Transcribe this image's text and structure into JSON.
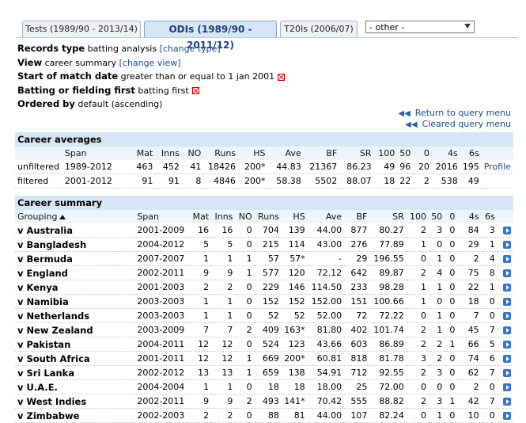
{
  "tabs": [
    {
      "label": "Tests (1989/90 - 2013/14)"
    },
    {
      "label": "ODIs (1989/90 - 2011/12)"
    },
    {
      "label": "T20Is (2006/07)"
    }
  ],
  "other_select": {
    "value": "- other -"
  },
  "query": {
    "records_label": "Records type",
    "records_value": "batting analysis",
    "records_link": "[change type]",
    "view_label": "View",
    "view_value": "career summary",
    "view_link": "[change view]",
    "start_label": "Start of match date",
    "start_value": "greater than or equal to 1 jan 2001",
    "bat_label": "Batting or fielding first",
    "bat_value": "batting first",
    "order_label": "Ordered by",
    "order_value": "default (ascending)"
  },
  "links": {
    "return": "Return to query menu",
    "cleared": "Cleared query menu"
  },
  "averages": {
    "caption": "Career averages",
    "headers": [
      "",
      "Span",
      "Mat",
      "Inns",
      "NO",
      "Runs",
      "HS",
      "Ave",
      "BF",
      "SR",
      "100",
      "50",
      "0",
      "4s",
      "6s",
      ""
    ],
    "rows": [
      [
        "unfiltered",
        "1989-2012",
        "463",
        "452",
        "41",
        "18426",
        "200*",
        "44.83",
        "21367",
        "86.23",
        "49",
        "96",
        "20",
        "2016",
        "195",
        "Profile"
      ],
      [
        "filtered",
        "2001-2012",
        "91",
        "91",
        "8",
        "4846",
        "200*",
        "58.38",
        "5502",
        "88.07",
        "18",
        "22",
        "2",
        "538",
        "49",
        ""
      ]
    ]
  },
  "summary": {
    "caption": "Career summary",
    "headers": [
      "Grouping",
      "Span",
      "Mat",
      "Inns",
      "NO",
      "Runs",
      "HS",
      "Ave",
      "BF",
      "SR",
      "100",
      "50",
      "0",
      "4s",
      "6s"
    ],
    "rows": [
      [
        "v Australia",
        "2001-2009",
        "16",
        "16",
        "0",
        "704",
        "139",
        "44.00",
        "877",
        "80.27",
        "2",
        "3",
        "0",
        "84",
        "3"
      ],
      [
        "v Bangladesh",
        "2004-2012",
        "5",
        "5",
        "0",
        "215",
        "114",
        "43.00",
        "276",
        "77.89",
        "1",
        "0",
        "0",
        "29",
        "1"
      ],
      [
        "v Bermuda",
        "2007-2007",
        "1",
        "1",
        "1",
        "57",
        "57*",
        "-",
        "29",
        "196.55",
        "0",
        "1",
        "0",
        "2",
        "4"
      ],
      [
        "v England",
        "2002-2011",
        "9",
        "9",
        "1",
        "577",
        "120",
        "72.12",
        "642",
        "89.87",
        "2",
        "4",
        "0",
        "75",
        "8"
      ],
      [
        "v Kenya",
        "2001-2003",
        "2",
        "2",
        "0",
        "229",
        "146",
        "114.50",
        "233",
        "98.28",
        "1",
        "1",
        "0",
        "22",
        "1"
      ],
      [
        "v Namibia",
        "2003-2003",
        "1",
        "1",
        "0",
        "152",
        "152",
        "152.00",
        "151",
        "100.66",
        "1",
        "0",
        "0",
        "18",
        "0"
      ],
      [
        "v Netherlands",
        "2003-2003",
        "1",
        "1",
        "0",
        "52",
        "52",
        "52.00",
        "72",
        "72.22",
        "0",
        "1",
        "0",
        "7",
        "0"
      ],
      [
        "v New Zealand",
        "2003-2009",
        "7",
        "7",
        "2",
        "409",
        "163*",
        "81.80",
        "402",
        "101.74",
        "2",
        "1",
        "0",
        "45",
        "7"
      ],
      [
        "v Pakistan",
        "2004-2011",
        "12",
        "12",
        "0",
        "524",
        "123",
        "43.66",
        "603",
        "86.89",
        "2",
        "2",
        "1",
        "66",
        "5"
      ],
      [
        "v South Africa",
        "2001-2011",
        "12",
        "12",
        "1",
        "669",
        "200*",
        "60.81",
        "818",
        "81.78",
        "3",
        "2",
        "0",
        "74",
        "6"
      ],
      [
        "v Sri Lanka",
        "2002-2012",
        "13",
        "13",
        "1",
        "659",
        "138",
        "54.91",
        "712",
        "92.55",
        "2",
        "3",
        "0",
        "62",
        "7"
      ],
      [
        "v U.A.E.",
        "2004-2004",
        "1",
        "1",
        "0",
        "18",
        "18",
        "18.00",
        "25",
        "72.00",
        "0",
        "0",
        "0",
        "2",
        "0"
      ],
      [
        "v West Indies",
        "2002-2011",
        "9",
        "9",
        "2",
        "493",
        "141*",
        "70.42",
        "555",
        "88.82",
        "2",
        "3",
        "1",
        "42",
        "7"
      ],
      [
        "v Zimbabwe",
        "2002-2003",
        "2",
        "2",
        "0",
        "88",
        "81",
        "44.00",
        "107",
        "82.24",
        "0",
        "1",
        "0",
        "10",
        "0"
      ]
    ]
  }
}
